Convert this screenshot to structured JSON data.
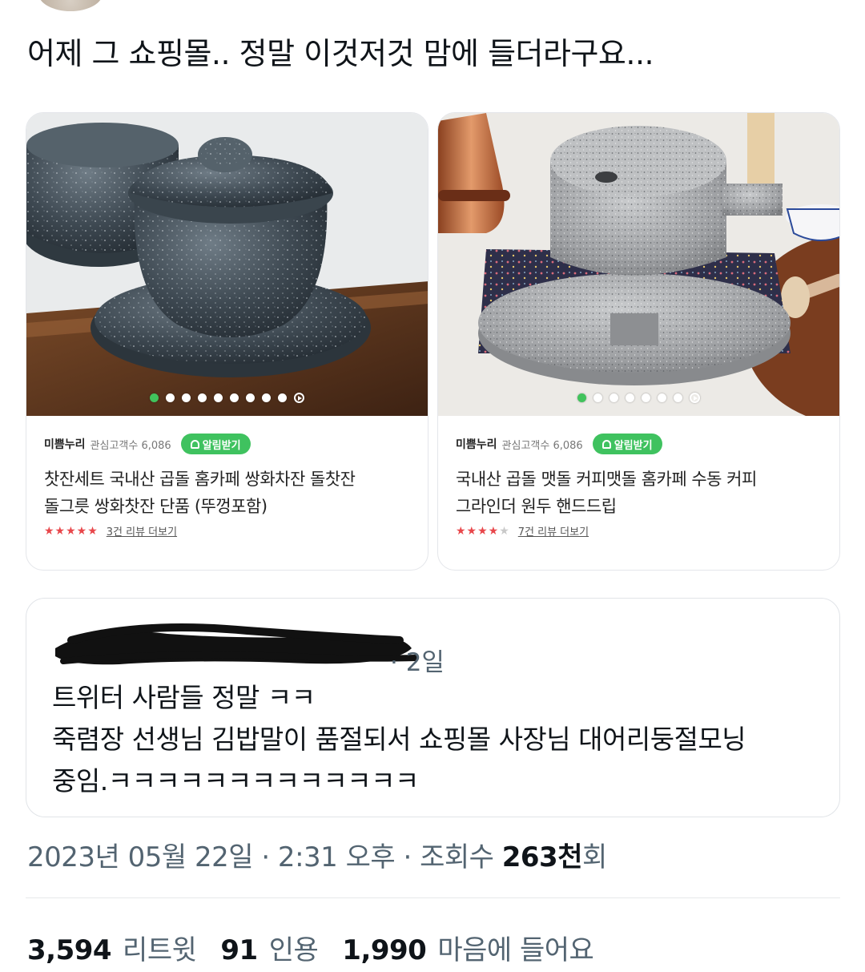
{
  "tweet": {
    "text": "어제 그 쇼핑몰.. 정말 이것저것 맘에 들더라구요..."
  },
  "products": [
    {
      "store": "미쁨누리",
      "followers": "관심고객수 6,086",
      "alarm_label": "알림받기",
      "title_line1": "찻잔세트 국내산 곱돌 홈카페 쌍화차잔 돌찻잔",
      "title_line2": "돌그릇 쌍화찻잔 단품 (뚜껑포함)",
      "stars": "★★★★★",
      "rating": 5,
      "review_link": "3건 리뷰 더보기",
      "image_icon": "stone-teacup-photo"
    },
    {
      "store": "미쁨누리",
      "followers": "관심고객수 6,086",
      "alarm_label": "알림받기",
      "title_line1": "국내산 곱돌 맷돌 커피맷돌 홈카페 수동 커피",
      "title_line2": "그라인더 원두 핸드드립",
      "stars": "★★★★",
      "stars_half": "★",
      "rating": 4.5,
      "review_link": "7건 리뷰 더보기",
      "image_icon": "stone-millstone-photo"
    }
  ],
  "quote": {
    "time": "· 2일",
    "line1": "트위터 사람들 정말 ㅋㅋ",
    "line2": "죽렴장 선생님 김밥말이 품절되서 쇼핑몰 사장님 대어리둥절모닝",
    "line3": "중임.ㅋㅋㅋㅋㅋㅋㅋㅋㅋㅋㅋㅋㅋ"
  },
  "meta": {
    "datetime": "2023년 05월 22일 · 2:31 오후 · 조회수 ",
    "views": "263천",
    "views_suffix": "회"
  },
  "stats": {
    "retweets": "3,594",
    "retweets_label": "리트윗",
    "quotes": "91",
    "quotes_label": "인용",
    "likes": "1,990",
    "likes_label": "마음에 들어요"
  },
  "colors": {
    "accent_green": "#3fc25f",
    "star_red": "#e8474b",
    "secondary_text": "#536471"
  }
}
